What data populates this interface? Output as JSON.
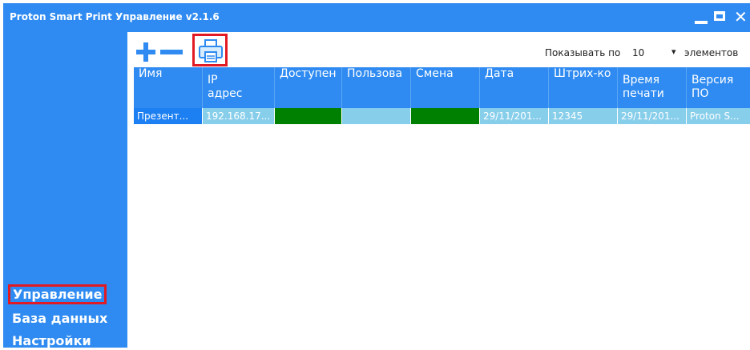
{
  "window": {
    "title": "Proton Smart Print Управление v2.1.6"
  },
  "sidebar": {
    "items": [
      {
        "label": "Управление",
        "active": true
      },
      {
        "label": "База данных",
        "active": false
      },
      {
        "label": "Настройки",
        "active": false
      }
    ]
  },
  "toolbar": {
    "icons": [
      "plus-icon",
      "minus-icon",
      "printer-icon"
    ]
  },
  "pager": {
    "label": "Показывать по",
    "value": "10",
    "suffix": "элементов"
  },
  "table": {
    "columns": [
      [
        "Имя"
      ],
      [
        "IP",
        "адрес"
      ],
      [
        "Доступен"
      ],
      [
        "Пользова"
      ],
      [
        "Смена"
      ],
      [
        "Дата"
      ],
      [
        "Штрих-ко"
      ],
      [
        "Время",
        "печати"
      ],
      [
        "Версия",
        "ПО"
      ]
    ],
    "rows": [
      [
        "Презент...",
        "192.168.17...",
        "",
        "",
        "",
        "29/11/201...",
        "12345",
        "29/11/201...",
        "Proton S..."
      ]
    ]
  },
  "colors": {
    "accent": "#2f8bf1",
    "highlight": "#e21a23",
    "row": "#87ceeb",
    "status": "#008000"
  }
}
